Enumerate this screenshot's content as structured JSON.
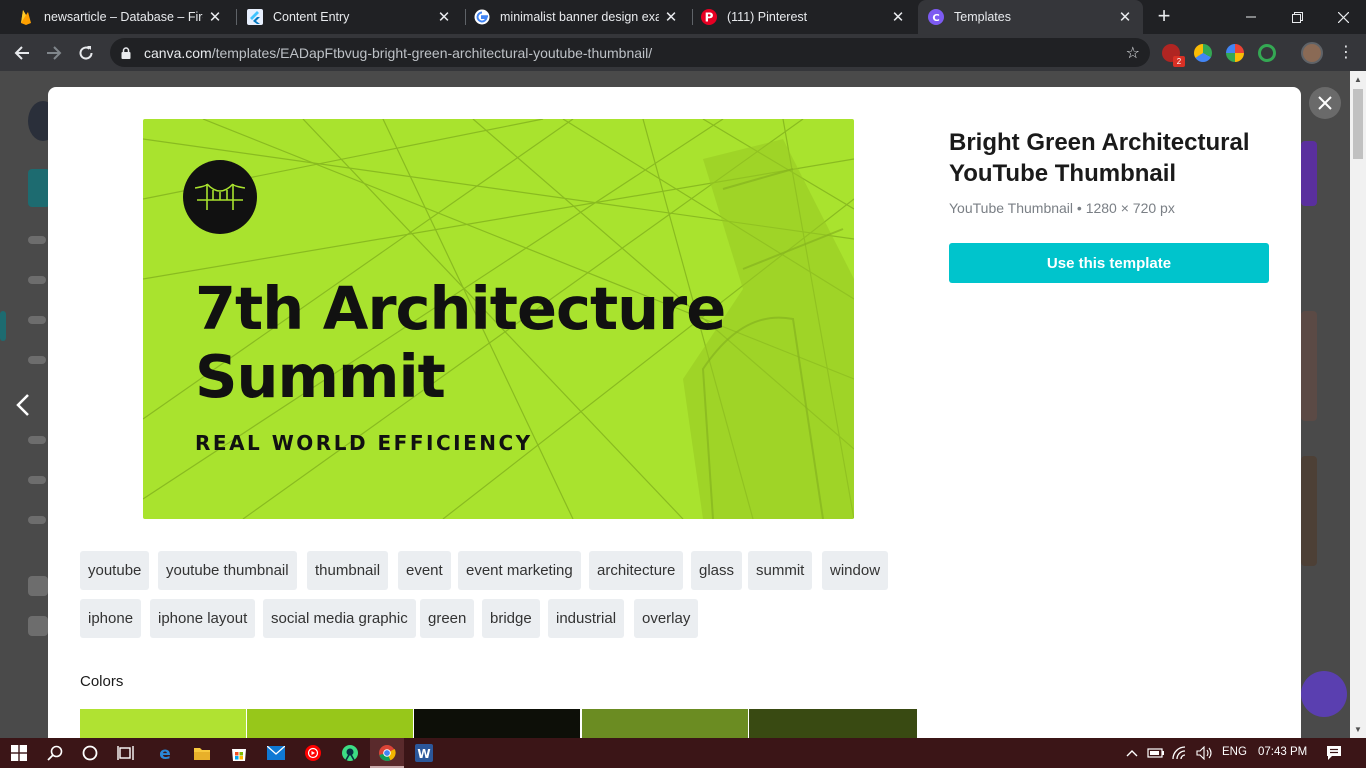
{
  "browser": {
    "tabs": [
      {
        "title": "newsarticle – Database – Fireb",
        "icon": "firebase-icon",
        "active": false
      },
      {
        "title": "Content Entry",
        "icon": "flutter-icon",
        "active": false
      },
      {
        "title": "minimalist banner design exan",
        "icon": "google-icon",
        "active": false
      },
      {
        "title": "(111) Pinterest",
        "icon": "pinterest-icon",
        "active": false
      },
      {
        "title": "Templates",
        "icon": "canva-icon",
        "active": true
      }
    ],
    "url_host": "canva.com",
    "url_path": "/templates/EADapFtbvug-bright-green-architectural-youtube-thumbnail/",
    "extension_badge": "2"
  },
  "template": {
    "title": "Bright Green Architectural YouTube Thumbnail",
    "meta": "YouTube Thumbnail • 1280 × 720 px",
    "use_button": "Use this template",
    "preview": {
      "headline_line1": "7th Architecture",
      "headline_line2": "Summit",
      "subline": "REAL WORLD EFFICIENCY",
      "background_color": "#a9e32e"
    }
  },
  "tags_row1": [
    "youtube",
    "youtube thumbnail",
    "thumbnail",
    "event",
    "event marketing",
    "architecture",
    "glass",
    "summit",
    "window"
  ],
  "tags_row2": [
    "iphone",
    "iphone layout",
    "social media graphic",
    "green",
    "bridge",
    "industrial",
    "overlay"
  ],
  "colors": {
    "label": "Colors",
    "swatches": [
      "#b0e232",
      "#97c71a",
      "#0d0f08",
      "#6b8c22",
      "#394a12"
    ]
  },
  "taskbar": {
    "language": "ENG",
    "time": "07:43 PM"
  }
}
